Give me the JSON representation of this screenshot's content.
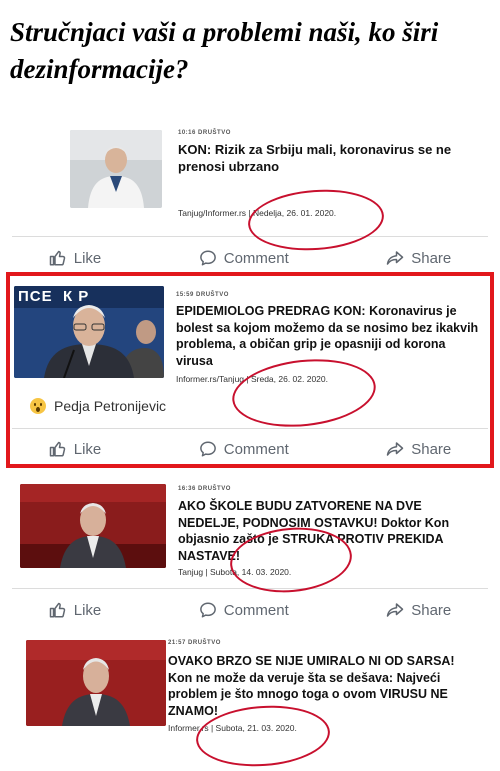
{
  "headline": "Stručnjaci vaši a problemi naši, ko širi dezinformacije?",
  "actions": {
    "like": "Like",
    "comment": "Comment",
    "share": "Share"
  },
  "posts": [
    {
      "time": "10:16",
      "category": "DRUŠTVO",
      "title": "KON: Rizik za Srbiju mali, koronavirus se ne prenosi ubrzano",
      "source": "Tanjug/Informer.rs | Nedelja, 26. 01. 2020."
    },
    {
      "time": "15:59",
      "category": "DRUŠTVO",
      "title": "EPIDEMIOLOG PREDRAG KON: Koronavirus je bolest sa kojom možemo da se nosimo bez ikakvih problema, a običan grip je opasniji od korona virusa",
      "source": "Informer.rs/Tanjug | Sreda, 26. 02. 2020.",
      "thumb_text": "ПСЕ  К Р",
      "reactor": "Pedja Petronijevic"
    },
    {
      "time": "16:36",
      "category": "DRUŠTVO",
      "title": "AKO ŠKOLE BUDU ZATVORENE NA DVE NEDELJE, PODNOSIM OSTAVKU! Doktor Kon objasnio zašto je STRUKA PROTIV PREKIDA NASTAVE!",
      "source": "Tanjug | Subota, 14. 03. 2020."
    },
    {
      "time": "21:57",
      "category": "DRUŠTVO",
      "title": "OVAKO BRZO SE NIJE UMIRALO NI OD SARSA! Kon ne može da veruje šta se dešava: Najveći problem je što mnogo toga o ovom VIRUSU NE ZNAMO!",
      "source": "Informer.rs | Subota, 21. 03. 2020."
    }
  ]
}
